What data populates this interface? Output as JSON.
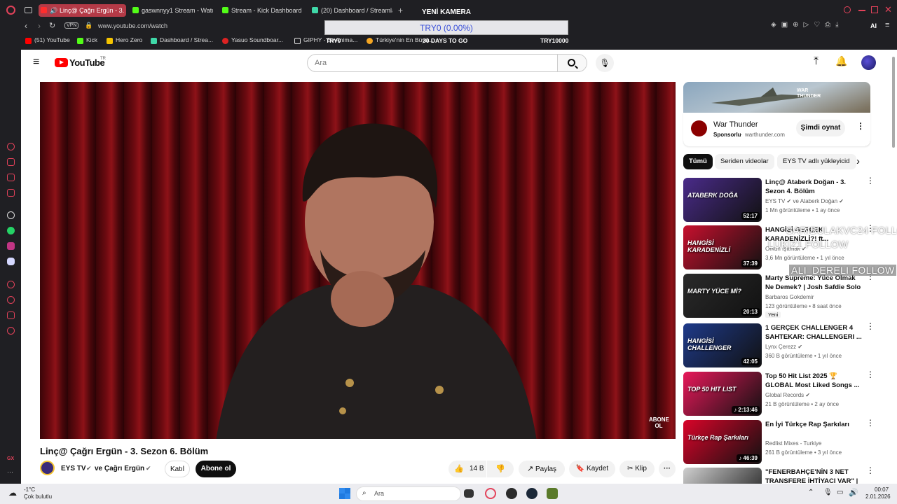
{
  "browser": {
    "tabs": [
      {
        "label": "Linç@ Çağrı Ergün - 3.",
        "color": "#ff2d2d",
        "active": true
      },
      {
        "label": "gaswnnyy1 Stream - Watc",
        "color": "#53fc18"
      },
      {
        "label": "Stream - Kick Dashboard",
        "color": "#53fc18"
      },
      {
        "label": "(20) Dashboard / Streamla",
        "color": "#3fd8a8"
      }
    ],
    "url": "www.youtube.com/watch",
    "vpn_label": "VPN",
    "bookmarks": [
      {
        "label": "(51) YouTube",
        "color": "#ff0000"
      },
      {
        "label": "Kick",
        "color": "#53fc18"
      },
      {
        "label": "Hero Zero",
        "color": "#f5c400"
      },
      {
        "label": "Dashboard / Strea...",
        "color": "#3fd8a8"
      },
      {
        "label": "Yasuo Soundboar...",
        "color": "#d22"
      },
      {
        "label": "GIPHY - Be Anima...",
        "color": "#fff"
      },
      {
        "label": "Türkiye'nin En Büyü...",
        "color": "#f5a623"
      }
    ],
    "ai_label": "AI"
  },
  "stream_overlay": {
    "camera_label": "YENİ KAMERA",
    "goal_value": "TRY0 (0.00%)",
    "start_label": "TRY0",
    "days_label": "30 DAYS TO GO",
    "target_label": "TRY10000",
    "follows": [
      "SARIBULAKVC24 FOLLOW",
      "LUKIZ1 FOLLOW",
      "",
      "ALI_DERELI FOLLOW"
    ]
  },
  "youtube": {
    "logo_text": "YouTube",
    "region": "TR",
    "search_placeholder": "Ara",
    "video_title": "Linç@ Çağrı Ergün - 3. Sezon 6. Bölüm",
    "channel": "EYS TV",
    "channel_collab": "ve Çağrı Ergün",
    "join_label": "Katıl",
    "subscribe_label": "Abone ol",
    "likes": "14 B",
    "share_label": "Paylaş",
    "save_label": "Kaydet",
    "clip_label": "Klip",
    "video_badge": "ABONE OL",
    "ad": {
      "title": "War Thunder",
      "sponsored": "Sponsorlu",
      "domain": "warthunder.com",
      "cta": "Şimdi oynat",
      "banner_text": "WAR THUNDER"
    },
    "chips": [
      "Tümü",
      "Seriden videolar",
      "EYS TV adlı yükleyicid"
    ],
    "recommendations": [
      {
        "title": "Linç@ Ataberk Doğan - 3. Sezon 4. Bölüm",
        "channel": "EYS TV ✔ ve Ataberk Doğan ✔",
        "meta": "1 Mn görüntüleme • 1 ay önce",
        "duration": "52:17",
        "thumb_color": "#4a2b8a",
        "thumb_text": "ATABERK DOĞA"
      },
      {
        "title": "HANGİSİ GERÇEK KARADENİZLİ?! ft...",
        "channel": "Orkun Işıtmak ✔",
        "meta": "3,6 Mn görüntüleme • 1 yıl önce",
        "duration": "37:39",
        "thumb_color": "#c8102e",
        "thumb_text": "HANGİSİ KARADENİZLİ"
      },
      {
        "title": "Marty Supreme: Yüce Olmak Ne Demek? | Josh Safdie Solo ...",
        "channel": "Barbaros Gokdemir",
        "meta": "123 görüntüleme • 8 saat önce",
        "duration": "20:13",
        "thumb_color": "#2a2a2a",
        "thumb_text": "MARTY YÜCE Mİ?",
        "badge": "Yeni"
      },
      {
        "title": "1 GERÇEK CHALLENGER 4 SAHTEKAR: CHALLENGERI ...",
        "channel": "Lynx Çerezz ✔",
        "meta": "360 B görüntüleme • 1 yıl önce",
        "duration": "42:05",
        "thumb_color": "#1e3a8a",
        "thumb_text": "HANGİSİ CHALLENGER"
      },
      {
        "title": "Top 50 Hit List 2025 🏆 GLOBAL Most Liked Songs ...",
        "channel": "Global Records ✔",
        "meta": "21 B görüntüleme • 2 ay önce",
        "duration": "♪ 2:13:46",
        "thumb_color": "#e8185a",
        "thumb_text": "TOP 50 HIT LIST"
      },
      {
        "title": "En İyi Türkçe Rap Şarkıları",
        "channel": "Redlist Mixes - Turkiye",
        "meta": "261 B görüntüleme • 3 yıl önce",
        "duration": "♪ 46:39",
        "thumb_color": "#d90429",
        "thumb_text": "Türkçe Rap Şarkıları"
      },
      {
        "title": "\"FENERBAHÇE'NİN 3 NET TRANSFERE İHTİYACI VAR\" |",
        "channel": "",
        "meta": "",
        "duration": "",
        "thumb_color": "#cfcfcf",
        "thumb_text": ""
      }
    ]
  },
  "taskbar": {
    "temp": "-1°C",
    "weather": "Çok bulutlu",
    "search_placeholder": "Ara",
    "time": "00:07",
    "date": "2.01.2026"
  }
}
